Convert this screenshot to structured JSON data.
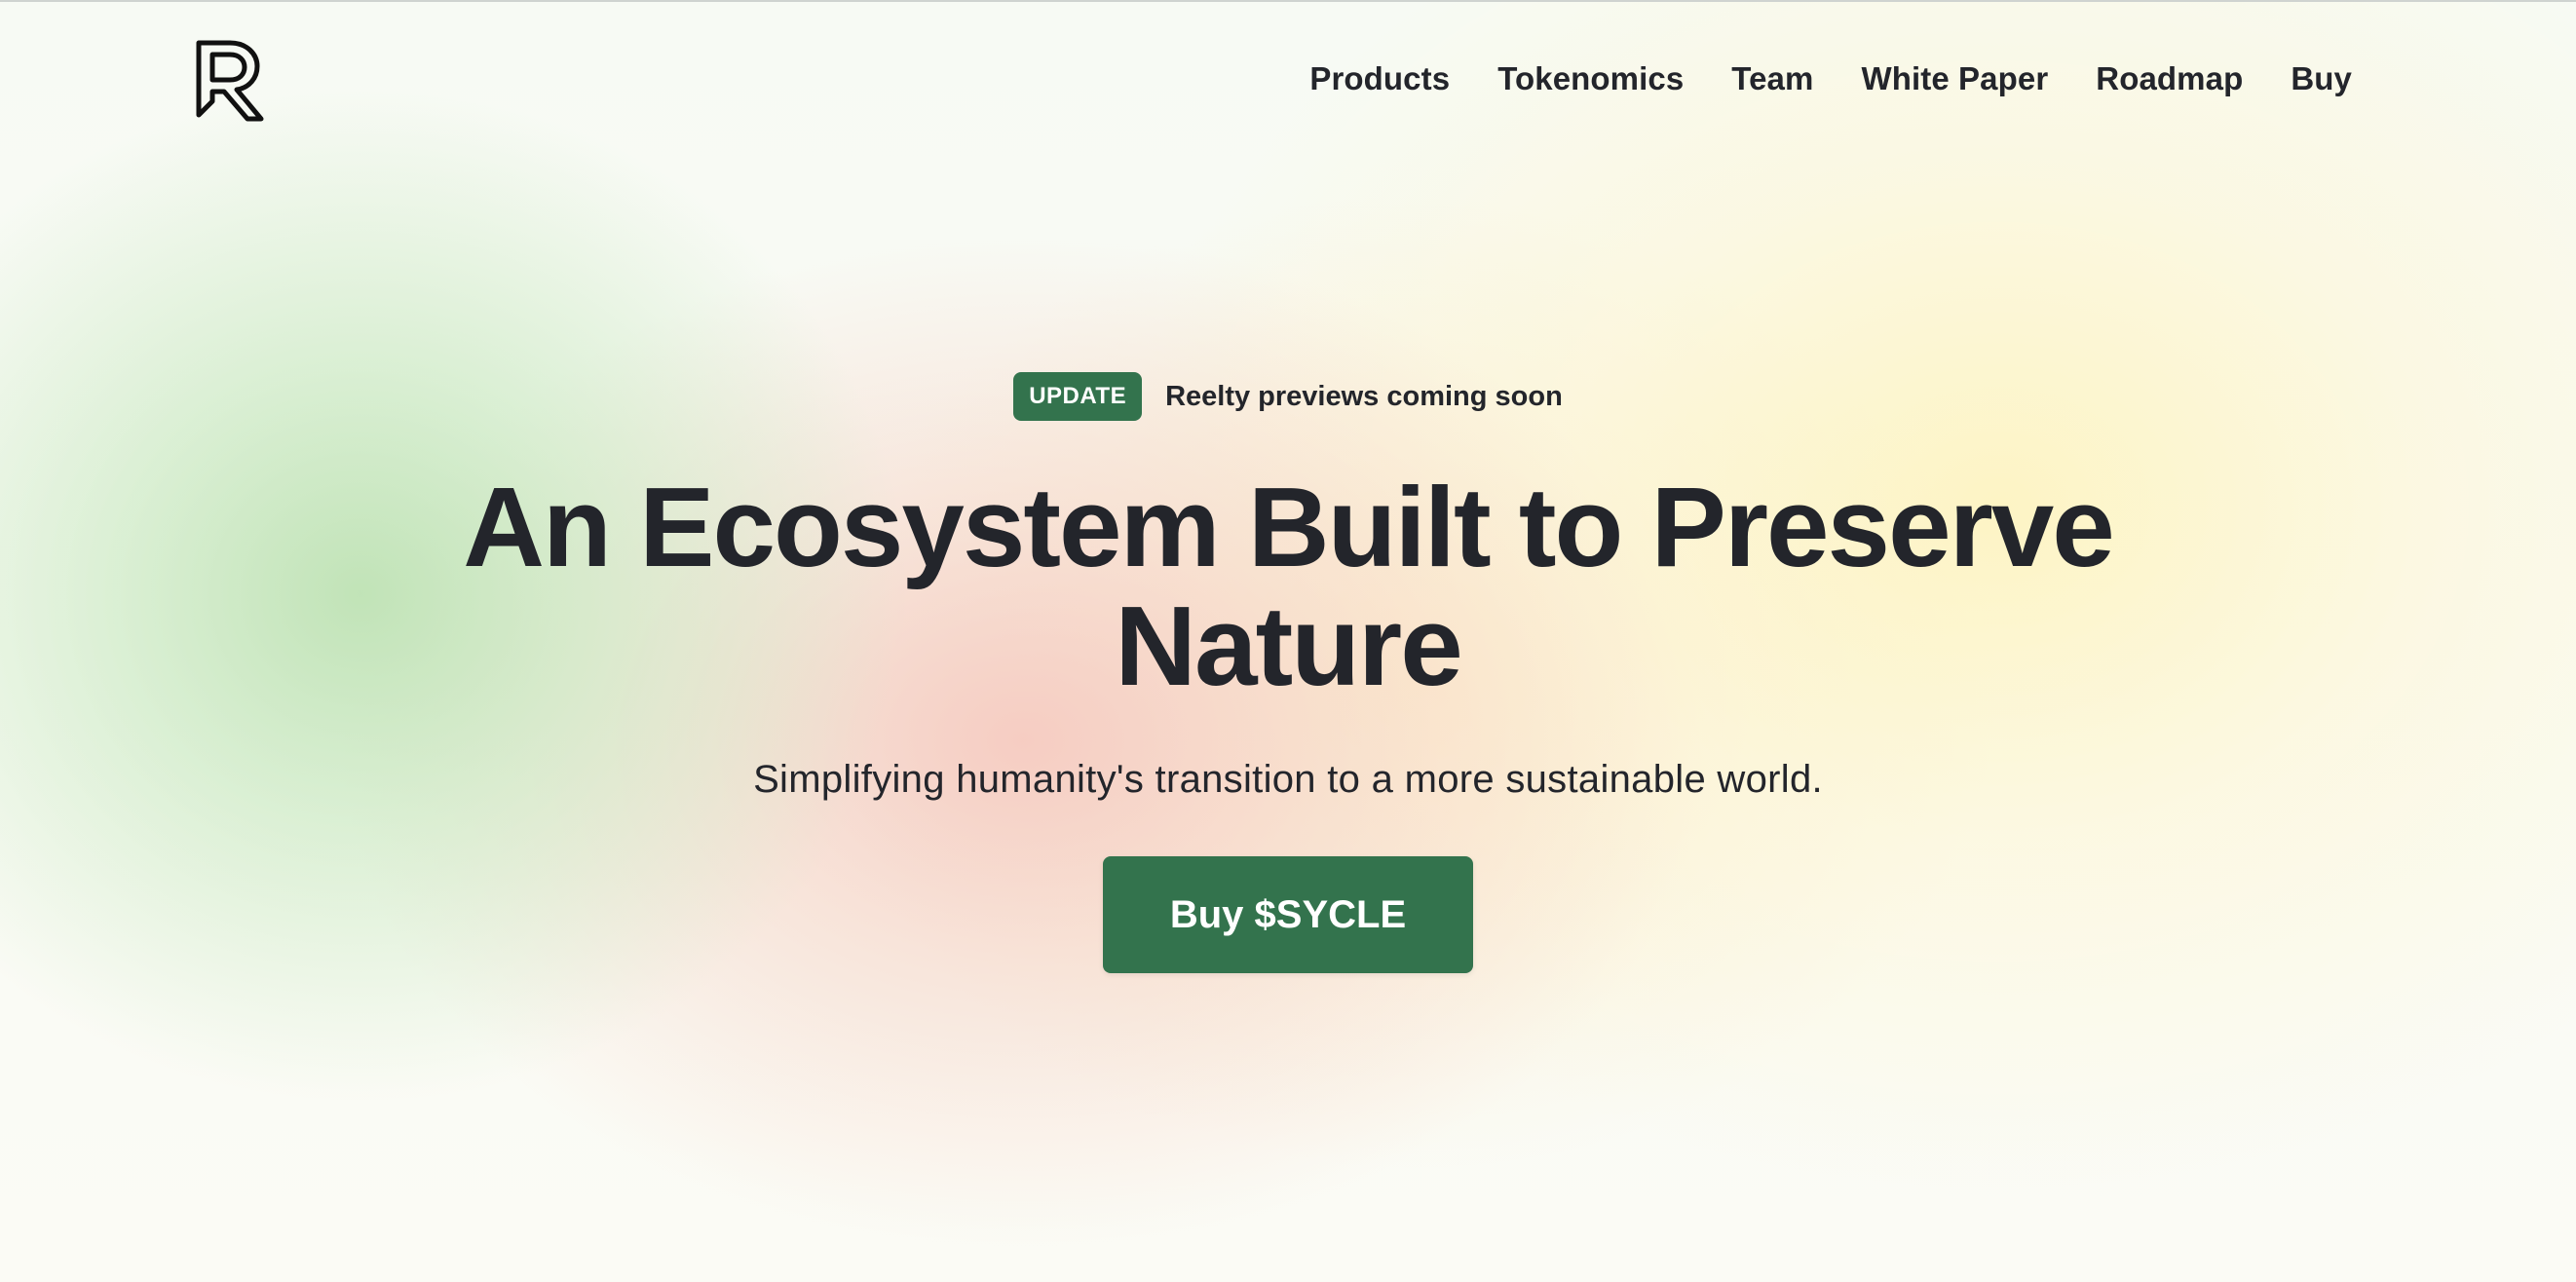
{
  "nav": {
    "links": [
      "Products",
      "Tokenomics",
      "Team",
      "White Paper",
      "Roadmap",
      "Buy"
    ]
  },
  "announcement": {
    "badge": "UPDATE",
    "text": "Reelty previews coming soon"
  },
  "hero": {
    "headline": "An Ecosystem Built to Preserve Nature",
    "subheadline": "Simplifying humanity's transition to a more sustainable world.",
    "cta_label": "Buy $SYCLE"
  },
  "colors": {
    "brand_green": "#33734d",
    "text_dark": "#23252b"
  },
  "icons": {
    "logo": "r-arrow-logo-icon"
  }
}
